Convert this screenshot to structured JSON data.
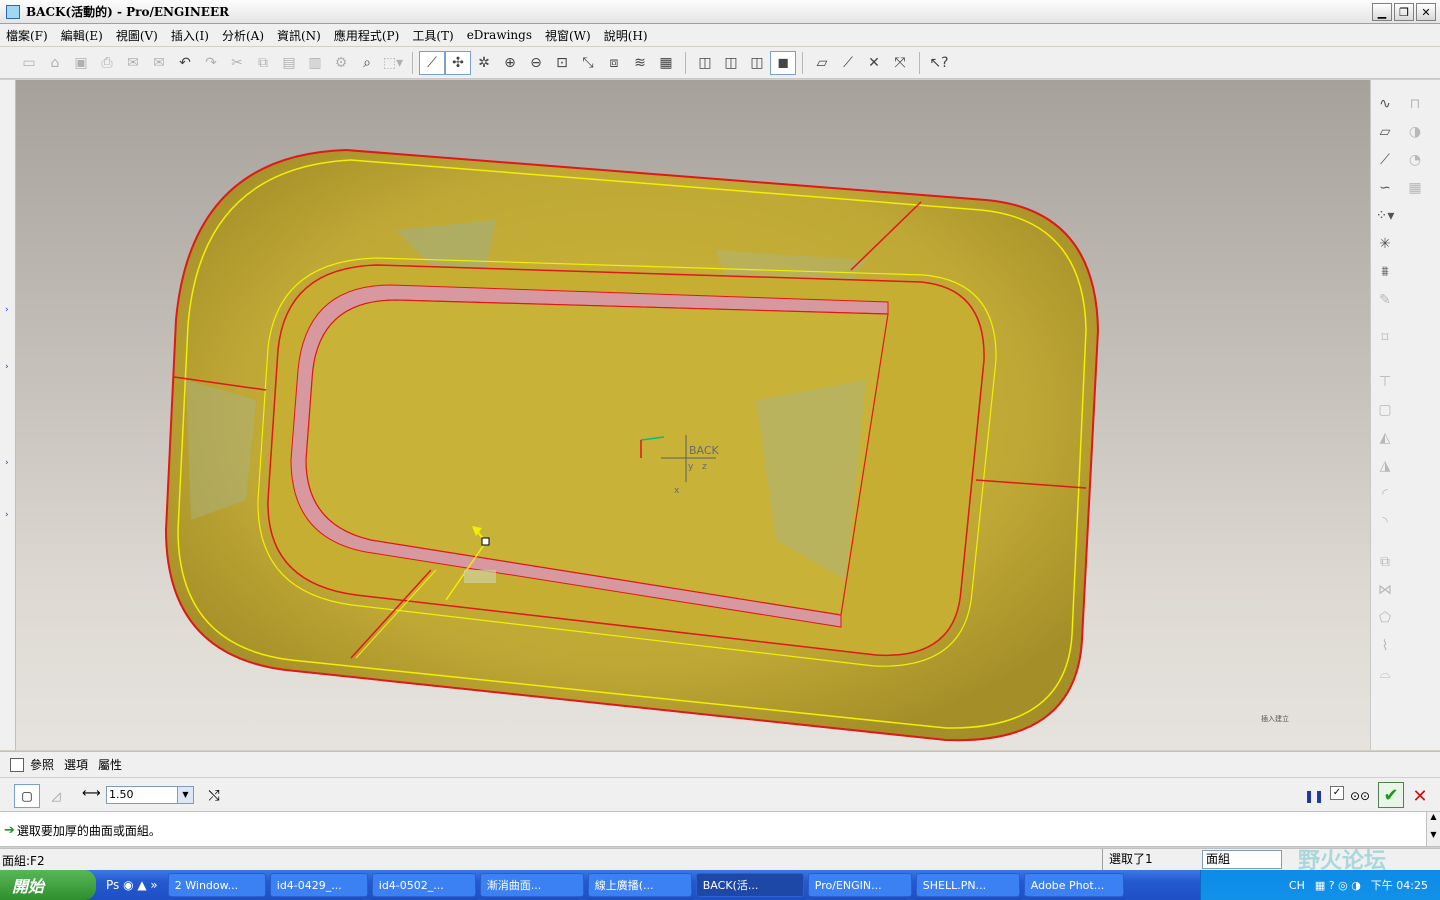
{
  "window": {
    "title": "BACK(活動的) - Pro/ENGINEER"
  },
  "menu": [
    "檔案(F)",
    "編輯(E)",
    "視圖(V)",
    "插入(I)",
    "分析(A)",
    "資訊(N)",
    "應用程式(P)",
    "工具(T)",
    "eDrawings",
    "視窗(W)",
    "說明(H)"
  ],
  "model": {
    "coord_label": "BACK",
    "axis_y": "y",
    "axis_z": "z",
    "axis_x": "x",
    "corner_note": "插入建立"
  },
  "dashboard": {
    "tabs": [
      "參照",
      "選項",
      "屬性"
    ],
    "thickness_value": "1.50",
    "options": [
      "1.50"
    ]
  },
  "message": {
    "prompt": "選取要加厚的曲面或面組。"
  },
  "status": {
    "left": "面組:F2",
    "selected": "選取了1",
    "filter": "面組"
  },
  "taskbar": {
    "start": "開始",
    "tasks": [
      {
        "label": "2 Window..."
      },
      {
        "label": "id4-0429_..."
      },
      {
        "label": "id4-0502_..."
      },
      {
        "label": "漸消曲面..."
      },
      {
        "label": "線上廣播(..."
      },
      {
        "label": "BACK(活..."
      },
      {
        "label": "Pro/ENGIN..."
      },
      {
        "label": "SHELL.PN..."
      },
      {
        "label": "Adobe Phot..."
      }
    ],
    "lang": "CH",
    "clock": "下午 04:25"
  },
  "watermark": "野火论坛",
  "colors": {
    "surface": "#c8b030",
    "edge_red": "#e01818",
    "edge_yellow": "#f0f000",
    "pink_rail": "#d898a0"
  }
}
